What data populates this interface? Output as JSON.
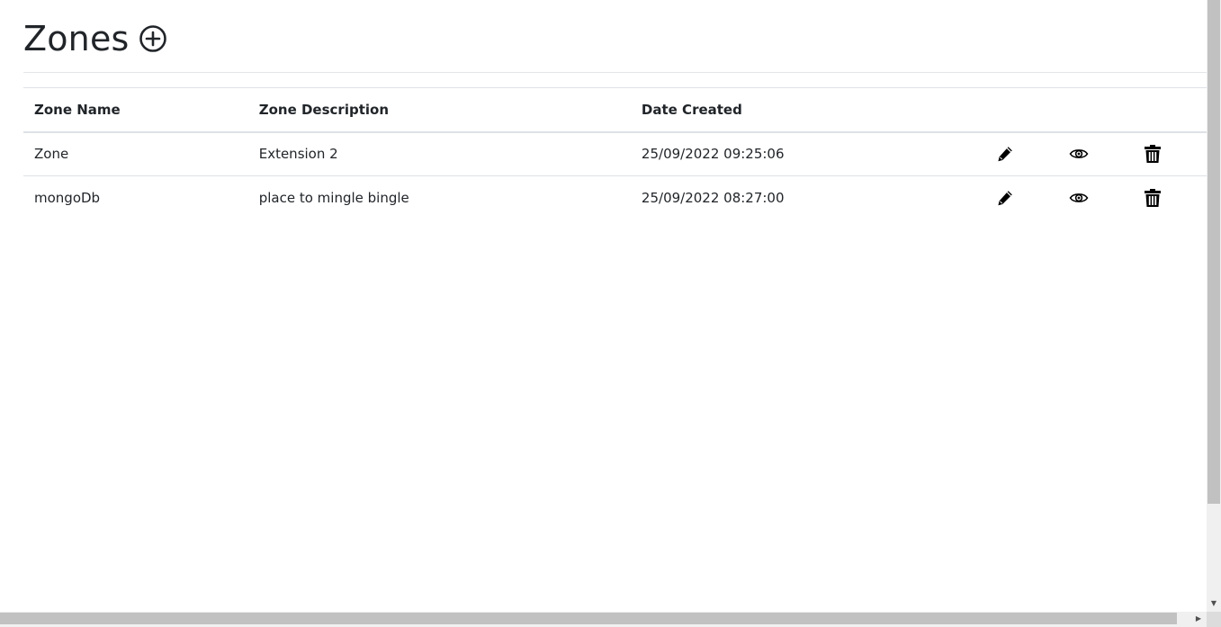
{
  "page": {
    "title": "Zones"
  },
  "table": {
    "headers": {
      "name": "Zone Name",
      "description": "Zone Description",
      "date": "Date Created"
    },
    "rows": [
      {
        "name": "Zone",
        "description": "Extension 2",
        "date": "25/09/2022 09:25:06"
      },
      {
        "name": "mongoDb",
        "description": "place to mingle bingle",
        "date": "25/09/2022 08:27:00"
      }
    ]
  },
  "icons": {
    "add": "plus-circle-icon",
    "edit": "pencil-icon",
    "view": "eye-icon",
    "delete": "trash-icon"
  },
  "colors": {
    "text": "#212529",
    "border": "#dee2e6",
    "icon": "#000000"
  }
}
